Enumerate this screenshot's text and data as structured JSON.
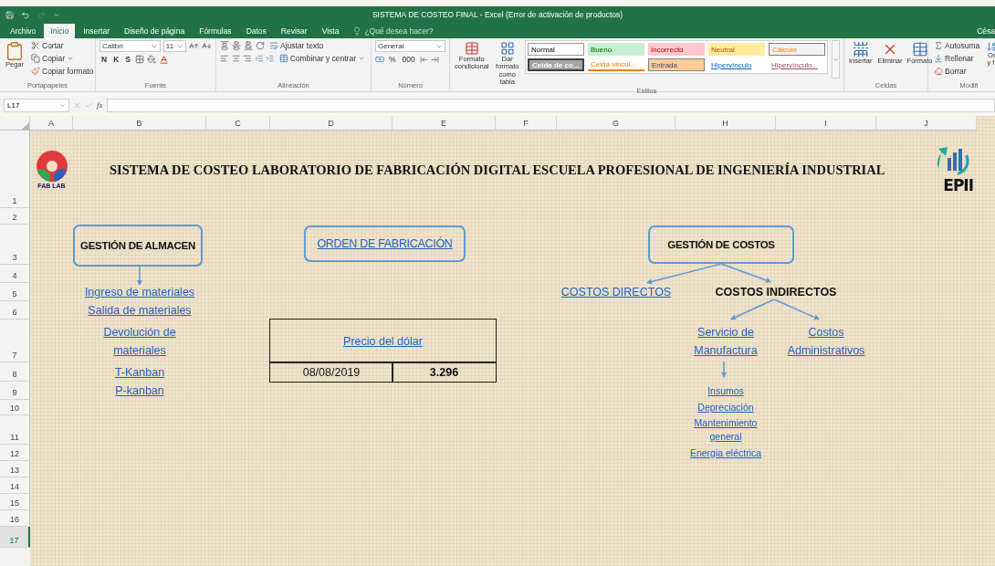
{
  "window": {
    "title": "SISTEMA DE COSTEO FINAL - Excel (Error de activación de productos)",
    "user": "Césa"
  },
  "tabs": [
    {
      "label": "Archivo",
      "selected": false
    },
    {
      "label": "Inicio",
      "selected": true
    },
    {
      "label": "Insertar",
      "selected": false
    },
    {
      "label": "Diseño de página",
      "selected": false
    },
    {
      "label": "Fórmulas",
      "selected": false
    },
    {
      "label": "Datos",
      "selected": false
    },
    {
      "label": "Revisar",
      "selected": false
    },
    {
      "label": "Vista",
      "selected": false
    }
  ],
  "tell_me": {
    "placeholder": "¿Qué desea hacer?"
  },
  "ribbon": {
    "clipboard": {
      "paste": "Pegar",
      "cut": "Cortar",
      "copy": "Copiar",
      "format_painter": "Copiar formato",
      "label": "Portapapeles"
    },
    "font": {
      "name": "Calibri",
      "size": "11",
      "styles": [
        "N",
        "K",
        "S"
      ],
      "label": "Fuente"
    },
    "alignment": {
      "wrap": "Ajustar texto",
      "merge": "Combinar y centrar",
      "label": "Alineación"
    },
    "number": {
      "format": "General",
      "percent": "%",
      "thousands": "000",
      "label": "Número"
    },
    "styles": {
      "conditional": "Formato condicional",
      "as_table": "Dar formato como tabla",
      "label": "Estilos",
      "gallery": [
        {
          "label": "Normal",
          "kind": "normal"
        },
        {
          "label": "Bueno",
          "kind": "good"
        },
        {
          "label": "Incorrecto",
          "kind": "bad"
        },
        {
          "label": "Neutral",
          "kind": "neutral"
        },
        {
          "label": "Cálculo",
          "kind": "calc"
        },
        {
          "label": "Celda de co...",
          "kind": "check"
        },
        {
          "label": "Celda vincul...",
          "kind": "linked"
        },
        {
          "label": "Entrada",
          "kind": "input"
        },
        {
          "label": "Hipervínculo",
          "kind": "link"
        },
        {
          "label": "Hipervínculo...",
          "kind": "followed"
        }
      ]
    },
    "cells": {
      "insert": "Insertar",
      "delete": "Eliminar",
      "format": "Formato",
      "label": "Celdas"
    },
    "editing": {
      "autosum": "Autosuma",
      "fill": "Rellenar",
      "clear": "Borrar",
      "sort": "Or",
      "sort_2": "y fi",
      "label": "Modifi"
    }
  },
  "formula_bar": {
    "name_box": "L17",
    "function_label": "fx"
  },
  "columns": [
    "A",
    "B",
    "C",
    "D",
    "E",
    "F",
    "G",
    "H",
    "I",
    "J"
  ],
  "rows": [
    {
      "label": "1",
      "selected": false
    },
    {
      "label": "2",
      "selected": false
    },
    {
      "label": "3",
      "selected": false
    },
    {
      "label": "4",
      "selected": false
    },
    {
      "label": "5",
      "selected": false
    },
    {
      "label": "6",
      "selected": false
    },
    {
      "label": "7",
      "selected": false
    },
    {
      "label": "8",
      "selected": false
    },
    {
      "label": "9",
      "selected": false
    },
    {
      "label": "10",
      "selected": false
    },
    {
      "label": "11",
      "selected": false
    },
    {
      "label": "12",
      "selected": false
    },
    {
      "label": "13",
      "selected": false
    },
    {
      "label": "14",
      "selected": false
    },
    {
      "label": "15",
      "selected": false
    },
    {
      "label": "16",
      "selected": false
    },
    {
      "label": "17",
      "selected": true
    }
  ],
  "sheet": {
    "title": "SISTEMA DE COSTEO LABORATORIO DE FABRICACIÓN DIGITAL ESCUELA PROFESIONAL DE INGENIERÍA INDUSTRIAL",
    "fab_lab_logo": "FAB LAB",
    "epii_logo": "EPII",
    "shapes": [
      {
        "label": "GESTIÓN DE ALMACEN",
        "kind": "heading"
      },
      {
        "label": "ORDEN DE FABRICACIÓN",
        "kind": "link"
      },
      {
        "label": "GESTIÓN DE COSTOS",
        "kind": "heading"
      }
    ],
    "cells": [
      {
        "text": "Ingreso de materiales",
        "kind": "link"
      },
      {
        "text": "Salida de materiales",
        "kind": "link"
      },
      {
        "text": "Devolución de materiales",
        "kind": "link"
      },
      {
        "text": "T-Kanban",
        "kind": "link"
      },
      {
        "text": "P-kanban",
        "kind": "link"
      },
      {
        "text": "COSTOS DIRECTOS",
        "kind": "link"
      },
      {
        "text": "COSTOS INDIRECTOS",
        "kind": "heading"
      },
      {
        "text": "Servicio de Manufactura",
        "kind": "link"
      },
      {
        "text": "Costos Administrativos",
        "kind": "link"
      },
      {
        "text": "Insumos",
        "kind": "small_link"
      },
      {
        "text": "Depreciación",
        "kind": "small_link"
      },
      {
        "text": "Mantenimiento general",
        "kind": "small_link"
      },
      {
        "text": "Energia eléctrica",
        "kind": "small_link"
      }
    ],
    "price_table": {
      "header": "Precio del dólar",
      "date": "08/08/2019",
      "value": "3.296"
    }
  }
}
